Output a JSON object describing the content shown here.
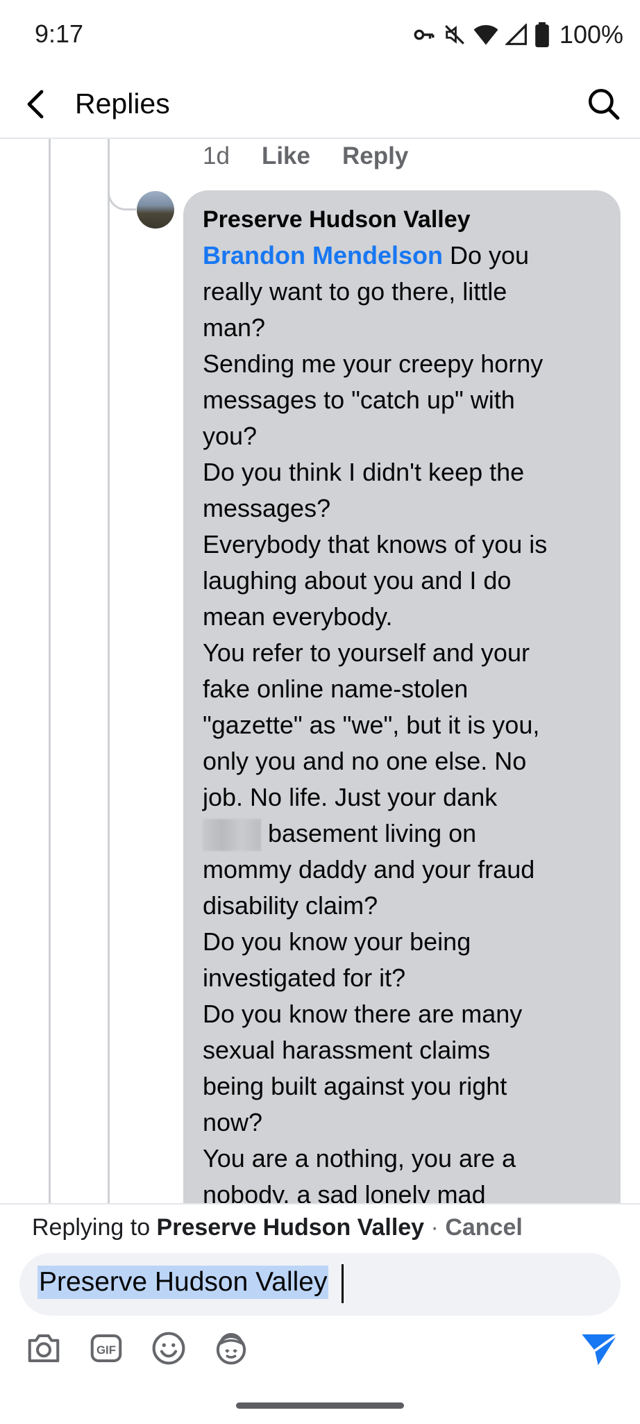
{
  "status_bar": {
    "time": "9:17",
    "battery": "100%",
    "icons": [
      "key-icon",
      "mute-icon",
      "wifi-icon",
      "signal-icon",
      "battery-icon"
    ]
  },
  "header": {
    "title": "Replies",
    "back_icon": "back-arrow-icon",
    "search_icon": "search-icon"
  },
  "parent_actions": {
    "age": "1d",
    "like": "Like",
    "reply": "Reply"
  },
  "comment": {
    "author": "Preserve Hudson Valley",
    "mention": "Brandon Mendelson",
    "lines": [
      " Do you",
      "really want to go there, little",
      "man?",
      "Sending me your creepy horny",
      "messages to \"catch up\" with",
      "you?",
      "Do you think I didn't keep the",
      "messages?",
      "Everybody that knows of you is",
      "laughing about you and I do",
      "mean everybody.",
      "You refer to yourself and your",
      "fake online name-stolen",
      "\"gazette\" as \"we\", but it is you,",
      "only you and no one else. No",
      "job. No life. Just your dank",
      "basement living on",
      "mommy daddy and your fraud",
      "disability claim?",
      "Do you know your being",
      "investigated for it?",
      "Do you know there are many",
      "sexual harassment claims",
      "being built against you right",
      "now?",
      "You are a nothing, you are a",
      "nobody, a sad lonely mad"
    ]
  },
  "reply_bar": {
    "replying_prefix": "Replying to ",
    "replying_name": "Preserve Hudson Valley",
    "separator": " · ",
    "cancel": "Cancel",
    "input_value": "Preserve Hudson Valley",
    "tools": [
      "camera-icon",
      "gif-icon",
      "emoji-icon",
      "avatar-sticker-icon"
    ],
    "send_icon": "send-icon"
  },
  "colors": {
    "accent": "#1877f2",
    "bubble": "#d0d2d6",
    "muted": "#65676b"
  }
}
